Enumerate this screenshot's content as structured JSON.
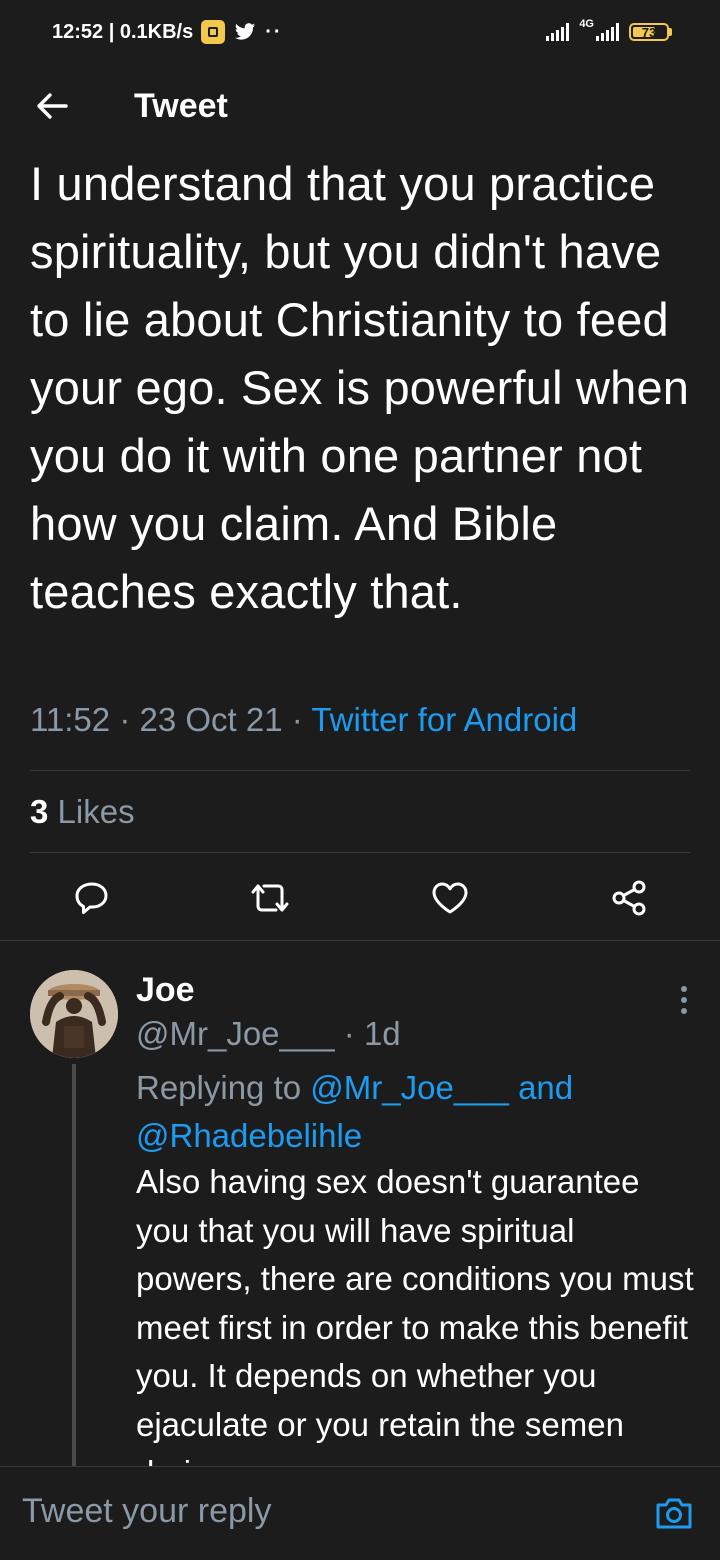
{
  "status_bar": {
    "time_speed": "12:52 | 0.1KB/s",
    "network": "4G",
    "battery_level": "73",
    "dots": "··"
  },
  "header": {
    "title": "Tweet"
  },
  "tweet": {
    "text": "I understand that you practice spirituality, but you didn't have to lie about Christianity to feed your ego. Sex is powerful when you do it with one partner not how you claim. And Bible teaches exactly that.",
    "time": "11:52",
    "date": "23 Oct 21",
    "separator": "·",
    "source": "Twitter for Android",
    "likes_count": "3",
    "likes_label": "Likes"
  },
  "reply": {
    "name": "Joe",
    "handle": "@Mr_Joe___",
    "age": "· 1d",
    "replying_to_label": "Replying to",
    "mention_1": "@Mr_Joe___",
    "and_label": "and",
    "mention_2": "@Rhadebelihle",
    "text": "Also having sex doesn't guarantee you that you will have spiritual powers, there are conditions you must meet first in order to make this benefit you. It depends on whether you ejaculate or you retain the semen during sex."
  },
  "composer": {
    "placeholder": "Tweet your reply"
  },
  "colors": {
    "background": "#1c1c1c",
    "accent": "#1d9bf0",
    "muted": "#8b98a5",
    "battery": "#f2c94c"
  },
  "icons": [
    "back-arrow-icon",
    "reply-icon",
    "retweet-icon",
    "like-icon",
    "share-icon",
    "more-vertical-icon",
    "camera-icon",
    "twitter-bird-icon"
  ]
}
